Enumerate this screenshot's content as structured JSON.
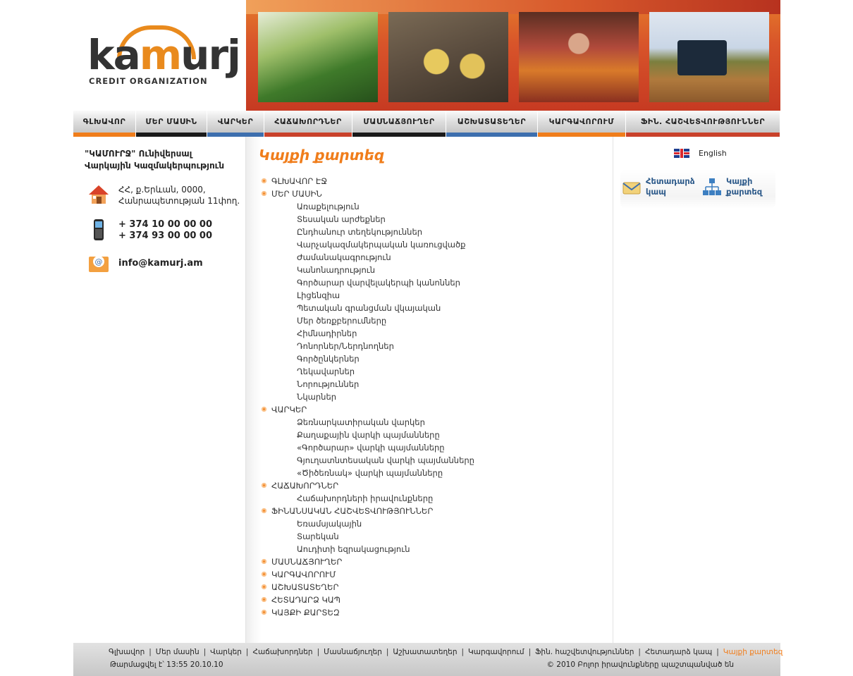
{
  "logo": {
    "word_left": "ka",
    "word_mid": "m",
    "word_right": "urj",
    "subtitle": "CREDIT ORGANIZATION"
  },
  "nav": [
    {
      "label": "ԳԼԽԱՎՈՐ",
      "accent": "#f07d1b"
    },
    {
      "label": "ՄԵՐ ՄԱՍԻՆ",
      "accent": "#1a1a1a"
    },
    {
      "label": "ՎԱՐԿԵՐ",
      "accent": "#3d6fae"
    },
    {
      "label": "ՀԱՃԱԽՈՐԴՆԵՐ",
      "accent": "#c9412a"
    },
    {
      "label": "ՄԱՍՆԱՃՅՈՒՂԵՐ",
      "accent": "#1a1a1a"
    },
    {
      "label": "ԱՇԽԱՏԱՏԵՂԵՐ",
      "accent": "#3d6fae"
    },
    {
      "label": "ԿԱՐԳԱՎՈՐՈՒՄ",
      "accent": "#f07d1b"
    },
    {
      "label": "ՖԻՆ. ՀԱՇՎԵՏՎՈՒԹՅՈՒՆՆԵՐ",
      "accent": "#c9412a"
    }
  ],
  "left": {
    "org_line1": "\"ԿԱՄՈՒՐՋ\" Ունիվերսալ",
    "org_line2": "Վարկային Կազմակերպություն",
    "address_line1": "ՀՀ, ք.Երևան, 0000,",
    "address_line2": "Հանրապետության 11փող.",
    "phone1": "+ 374 10 00 00 00",
    "phone2": "+ 374 93 00 00 00",
    "email": "info@kamurj.am"
  },
  "main": {
    "title": "Կայքի քարտեզ",
    "sitemap": [
      {
        "label": "ԳԼԽԱՎՈՐ ԷՋ",
        "level": 0
      },
      {
        "label": "ՄԵՐ ՄԱՍԻՆ",
        "level": 0
      },
      {
        "label": "Առաքելություն",
        "level": 1
      },
      {
        "label": "Տեսական արժեքներ",
        "level": 1
      },
      {
        "label": "Ընդհանուր տեղեկություններ",
        "level": 1
      },
      {
        "label": "Վարչակազմակերպական կառուցվածք",
        "level": 1
      },
      {
        "label": "Ժամանակագրություն",
        "level": 1
      },
      {
        "label": "Կանոնադրություն",
        "level": 1
      },
      {
        "label": "Գործարար վարվելակերպի կանոններ",
        "level": 1
      },
      {
        "label": "Լիցենզիա",
        "level": 1
      },
      {
        "label": "Պետական գրանցման վկայական",
        "level": 1
      },
      {
        "label": "Մեր ծեռքբերումները",
        "level": 1
      },
      {
        "label": "Հիմնադիրներ",
        "level": 1
      },
      {
        "label": "Դոնորներ/Ներդնողներ",
        "level": 1
      },
      {
        "label": "Գործընկերներ",
        "level": 1
      },
      {
        "label": "Ղեկավարներ",
        "level": 1
      },
      {
        "label": "Նորություններ",
        "level": 1
      },
      {
        "label": "Նկարներ",
        "level": 1
      },
      {
        "label": "ՎԱՐԿԵՐ",
        "level": 0
      },
      {
        "label": "Ձեռնարկատիրական վարկեր",
        "level": 1
      },
      {
        "label": "Քաղաքային վարկի պայմանները",
        "level": 1
      },
      {
        "label": "«Գործարար» վարկի պայմանները",
        "level": 1
      },
      {
        "label": "Գյուղատնտեսական վարկի պայմանները",
        "level": 1
      },
      {
        "label": "«Ծիծեռնակ» վարկի պայմանները",
        "level": 1
      },
      {
        "label": "ՀԱՃԱԽՈՐԴՆԵՐ",
        "level": 0
      },
      {
        "label": "Հաճախորդների իրավունքները",
        "level": 1
      },
      {
        "label": "ՖԻՆԱՆՍԱԿԱՆ ՀԱՇՎԵՏՎՈՒԹՅՈՒՆՆԵՐ",
        "level": 0
      },
      {
        "label": "Եռամսյակային",
        "level": 1
      },
      {
        "label": "Տարեկան",
        "level": 1
      },
      {
        "label": "Աուդիտի եզրակացություն",
        "level": 1
      },
      {
        "label": "ՄԱՍՆԱՃՅՈՒՂԵՐ",
        "level": 0
      },
      {
        "label": "ԿԱՐԳԱՎՈՐՈՒՄ",
        "level": 0
      },
      {
        "label": "ԱՇԽԱՏԱՏԵՂԵՐ",
        "level": 0
      },
      {
        "label": "ՀԵՏԱԴԱՐՁ ԿԱՊ",
        "level": 0
      },
      {
        "label": "ԿԱՅՔԻ ՔԱՐՏԵԶ",
        "level": 0
      }
    ]
  },
  "right": {
    "lang_label": "English",
    "feedback_line1": "Հետադարձ",
    "feedback_line2": "կապ",
    "sitemap_line1": "Կայքի",
    "sitemap_line2": "քարտեզ"
  },
  "footer": {
    "links": [
      "Գլխավոր",
      "Մեր մասին",
      "Վարկեր",
      "Հաճախորդներ",
      "Մասնաճյուղեր",
      "Աշխատատեղեր",
      "Կարգավորում",
      "Ֆին. հաշվետվություններ",
      "Հետադարձ կապ",
      "Կայքի քարտեզ"
    ],
    "updated": "Թարմացվել է՝ 13:55  20.10.10",
    "copyright": "© 2010 Բոլոր իրավունքները պաշտպանված են"
  },
  "colors": {
    "accent": "#f07d1b",
    "link_blue": "#2d5a8a"
  }
}
